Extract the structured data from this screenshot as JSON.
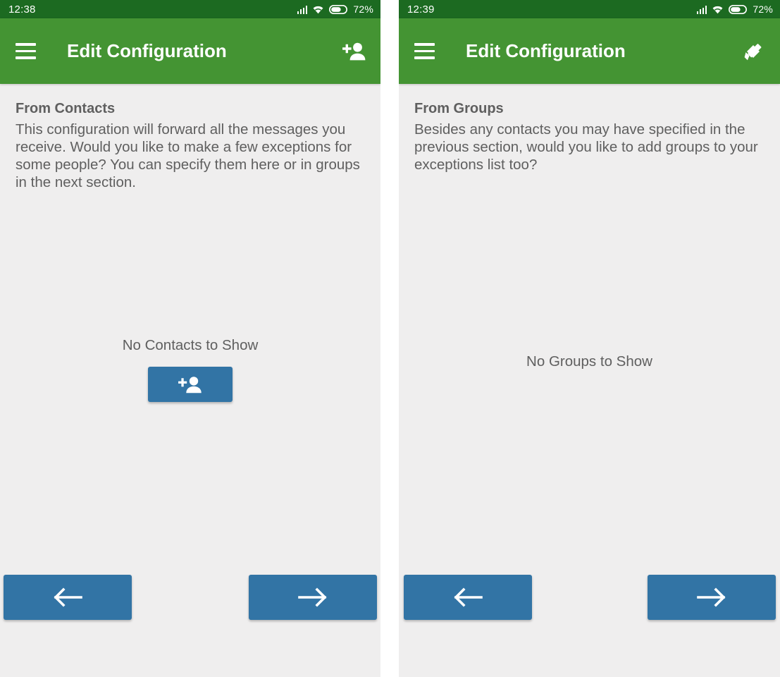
{
  "panels": [
    {
      "status": {
        "clock": "12:38",
        "battery_percent": "72%",
        "signal_icon": "signal-bars-icon",
        "wifi_icon": "wifi-icon",
        "battery_icon": "battery-icon"
      },
      "appbar": {
        "menu_icon": "hamburger-menu-icon",
        "title": "Edit Configuration",
        "action_icon": "add-person-icon"
      },
      "section": {
        "title": "From Contacts",
        "description": "This configuration will forward all the messages you receive. Would you like to make a few exceptions for some people? You can specify them here or in groups in the next section."
      },
      "empty": {
        "message": "No Contacts to Show",
        "add_button_icon": "add-person-icon",
        "has_add_button": true
      },
      "nav": {
        "prev_icon": "arrow-left-icon",
        "next_icon": "arrow-right-icon"
      }
    },
    {
      "status": {
        "clock": "12:39",
        "battery_percent": "72%",
        "signal_icon": "signal-bars-icon",
        "wifi_icon": "wifi-icon",
        "battery_icon": "battery-icon"
      },
      "appbar": {
        "menu_icon": "hamburger-menu-icon",
        "title": "Edit Configuration",
        "action_icon": "pencil-edit-icon"
      },
      "section": {
        "title": "From Groups",
        "description": "Besides any contacts you may have specified in the previous section, would you like to add groups to your exceptions list too?"
      },
      "empty": {
        "message": "No Groups to Show",
        "add_button_icon": "",
        "has_add_button": false
      },
      "nav": {
        "prev_icon": "arrow-left-icon",
        "next_icon": "arrow-right-icon"
      }
    }
  ],
  "colors": {
    "statusbar_green": "#1c6a21",
    "appbar_green": "#449433",
    "content_background": "#efeeee",
    "button_blue": "#3274a5",
    "text_gray": "#5f5f5f",
    "icon_white": "#ffffff"
  }
}
